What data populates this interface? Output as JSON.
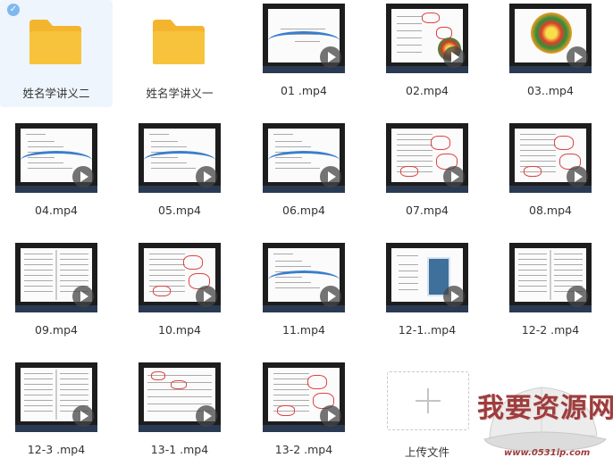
{
  "items": [
    {
      "name": "姓名学讲义二",
      "kind": "folder",
      "selected": true
    },
    {
      "name": "姓名学讲义一",
      "kind": "folder"
    },
    {
      "name": "01 .mp4",
      "kind": "video",
      "style": "title"
    },
    {
      "name": "02.mp4",
      "kind": "video",
      "style": "diagram"
    },
    {
      "name": "03..mp4",
      "kind": "video",
      "style": "mandala"
    },
    {
      "name": "04.mp4",
      "kind": "video",
      "style": "list"
    },
    {
      "name": "05.mp4",
      "kind": "video",
      "style": "list"
    },
    {
      "name": "06.mp4",
      "kind": "video",
      "style": "list"
    },
    {
      "name": "07.mp4",
      "kind": "video",
      "style": "notes"
    },
    {
      "name": "08.mp4",
      "kind": "video",
      "style": "notes"
    },
    {
      "name": "09.mp4",
      "kind": "video",
      "style": "book"
    },
    {
      "name": "10.mp4",
      "kind": "video",
      "style": "notes"
    },
    {
      "name": "11.mp4",
      "kind": "video",
      "style": "list"
    },
    {
      "name": "12-1..mp4",
      "kind": "video",
      "style": "card"
    },
    {
      "name": "12-2 .mp4",
      "kind": "video",
      "style": "book"
    },
    {
      "name": "12-3 .mp4",
      "kind": "video",
      "style": "book"
    },
    {
      "name": "13-1 .mp4",
      "kind": "video",
      "style": "table"
    },
    {
      "name": "13-2 .mp4",
      "kind": "video",
      "style": "notes"
    },
    {
      "name": "上传文件",
      "kind": "upload"
    }
  ],
  "icons": {
    "check": "check-icon",
    "folder": "folder-icon",
    "play": "play-icon",
    "upload": "plus-icon"
  },
  "colors": {
    "folder": "#f8c33c",
    "selected_bg": "#eef5fd",
    "watermark": "#9d3d3d"
  },
  "watermark": {
    "text": "我要资源网",
    "url": "www.0531ip.com"
  }
}
